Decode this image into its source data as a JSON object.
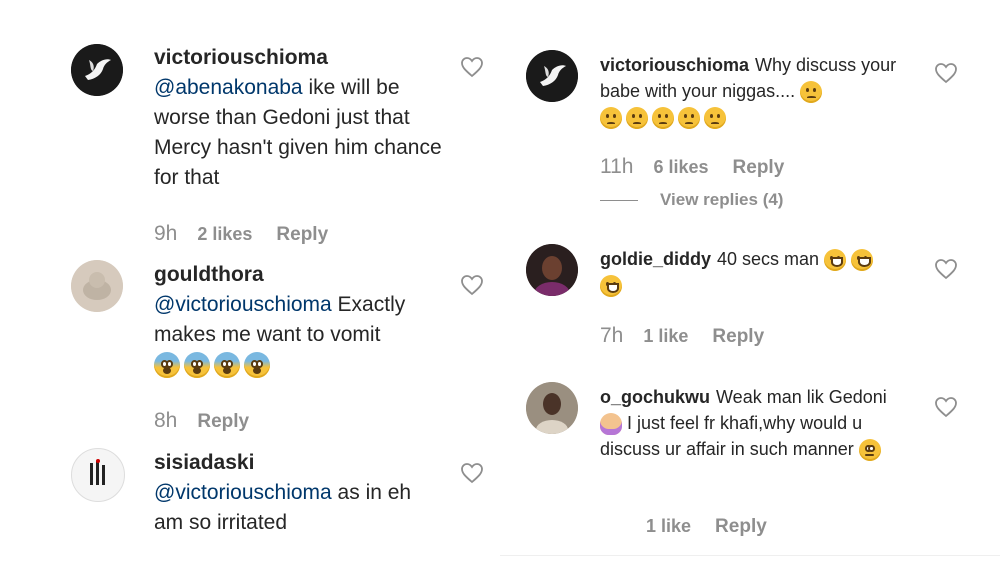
{
  "comments_left": [
    {
      "username": "victoriouschioma",
      "mention": "@abenakonaba",
      "text": " ike will be worse than Gedoni just that Mercy hasn't given him chance for that",
      "time": "9h",
      "likes": "2 likes",
      "reply": "Reply",
      "avatar": "dove-avatar"
    },
    {
      "username": "gouldthora",
      "mention": "@victoriouschioma",
      "text": " Exactly makes me want to vomit",
      "emojis": [
        "fear",
        "fear",
        "fear",
        "fear"
      ],
      "time": "8h",
      "reply": "Reply",
      "avatar": "sketch-avatar"
    },
    {
      "username": "sisiadaski",
      "mention": "@victoriouschioma",
      "text": " as in eh am so irritated",
      "avatar": "logo-avatar"
    }
  ],
  "comments_right": [
    {
      "username": "victoriouschioma",
      "text": "Why discuss your babe with your niggas....",
      "emojis": [
        "sad",
        "sad",
        "sad",
        "sad",
        "sad",
        "sad"
      ],
      "time": "11h",
      "likes": "6 likes",
      "reply": "Reply",
      "view_replies": "View replies (4)",
      "avatar": "dove-avatar"
    },
    {
      "username": "goldie_diddy",
      "text": "40 secs man",
      "emojis": [
        "grin",
        "grin",
        "grin"
      ],
      "time": "7h",
      "likes": "1 like",
      "reply": "Reply",
      "avatar": "photo-avatar"
    },
    {
      "username": "o_gochukwu",
      "text_part1": "Weak man lik Gedoni",
      "text_part2": "I just feel fr khafi,why would u discuss ur affair in such manner",
      "emojis": [
        "person",
        "roll"
      ],
      "likes": "1 like",
      "reply": "Reply",
      "avatar": "selfie-avatar"
    }
  ],
  "colors": {
    "text": "#262626",
    "mention": "#00376b",
    "meta": "#8e8e8e",
    "divider": "#efefef"
  },
  "icons": {
    "like": "heart-outline-icon"
  }
}
